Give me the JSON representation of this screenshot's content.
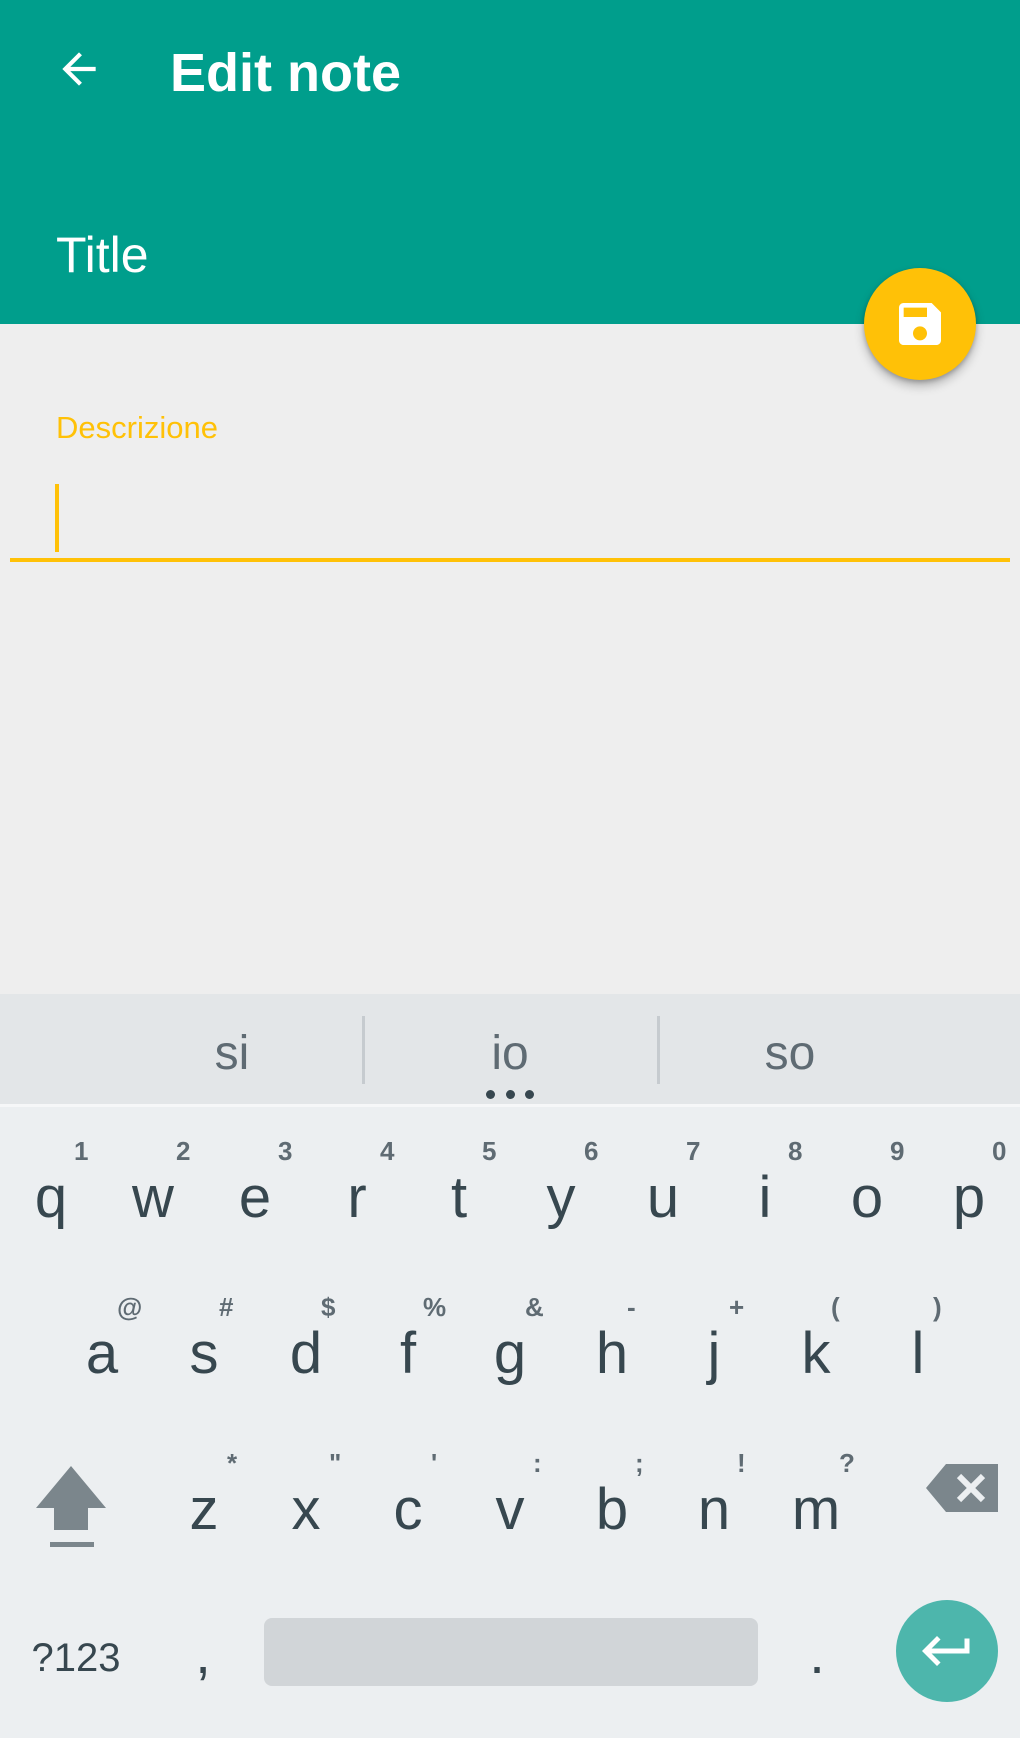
{
  "app_bar": {
    "title": "Edit note",
    "back_icon": "arrow-back-icon",
    "color": "#009e8c"
  },
  "note": {
    "title": "Title"
  },
  "fab": {
    "icon": "save-floppy-icon",
    "color": "#ffc107"
  },
  "description_field": {
    "label": "Descrizione",
    "value": "",
    "accent_color": "#ffc107"
  },
  "keyboard": {
    "suggestions": [
      "si",
      "io",
      "so"
    ],
    "row1": [
      {
        "key": "q",
        "hint": "1"
      },
      {
        "key": "w",
        "hint": "2"
      },
      {
        "key": "e",
        "hint": "3"
      },
      {
        "key": "r",
        "hint": "4"
      },
      {
        "key": "t",
        "hint": "5"
      },
      {
        "key": "y",
        "hint": "6"
      },
      {
        "key": "u",
        "hint": "7"
      },
      {
        "key": "i",
        "hint": "8"
      },
      {
        "key": "o",
        "hint": "9"
      },
      {
        "key": "p",
        "hint": "0"
      }
    ],
    "row2": [
      {
        "key": "a",
        "hint": "@"
      },
      {
        "key": "s",
        "hint": "#"
      },
      {
        "key": "d",
        "hint": "$"
      },
      {
        "key": "f",
        "hint": "%"
      },
      {
        "key": "g",
        "hint": "&"
      },
      {
        "key": "h",
        "hint": "-"
      },
      {
        "key": "j",
        "hint": "+"
      },
      {
        "key": "k",
        "hint": "("
      },
      {
        "key": "l",
        "hint": ")"
      }
    ],
    "row3": [
      {
        "key": "z",
        "hint": "*"
      },
      {
        "key": "x",
        "hint": "\""
      },
      {
        "key": "c",
        "hint": "'"
      },
      {
        "key": "v",
        "hint": ":"
      },
      {
        "key": "b",
        "hint": ";"
      },
      {
        "key": "n",
        "hint": "!"
      },
      {
        "key": "m",
        "hint": "?"
      }
    ],
    "shift_icon": "shift-arrow-icon",
    "backspace_icon": "backspace-icon",
    "symbols_label": "?123",
    "comma_label": ",",
    "period_label": ".",
    "enter_icon": "enter-return-icon",
    "enter_color": "#4db6ac"
  }
}
